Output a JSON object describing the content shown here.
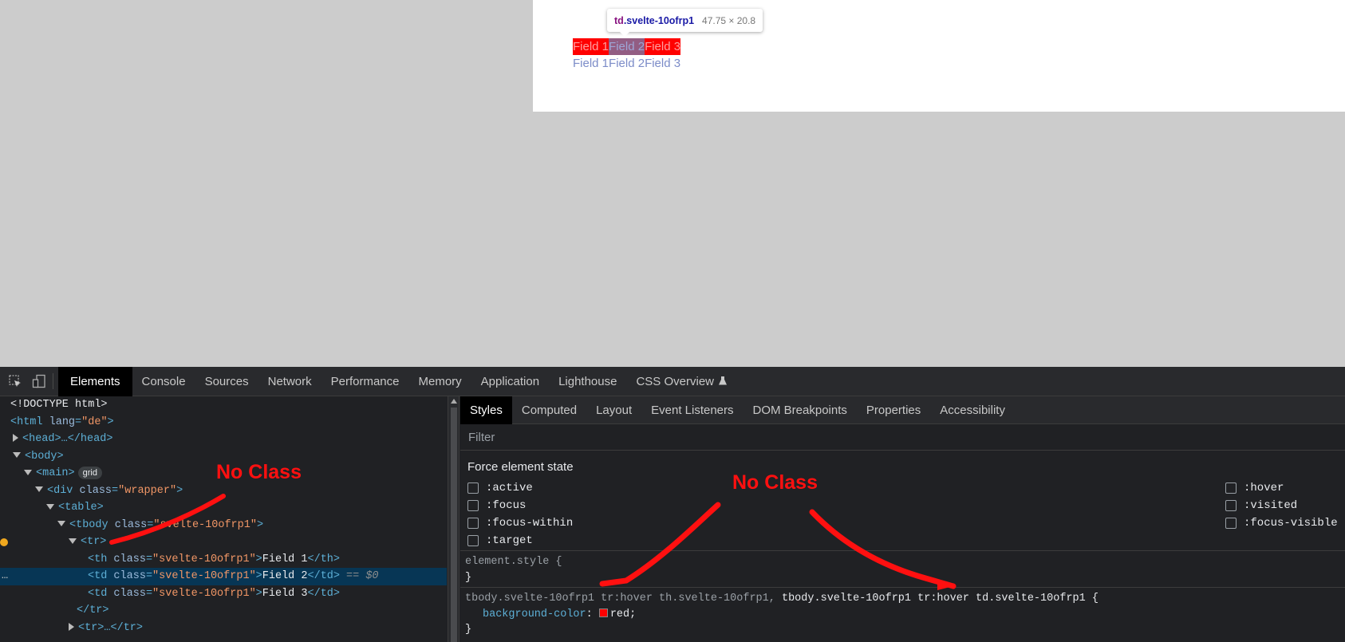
{
  "viewport": {
    "tooltip": {
      "tag": "td",
      "class": ".svelte-10ofrp1",
      "size": "47.75 × 20.8"
    },
    "rows": [
      [
        "Field 1",
        "Field 2",
        "Field 3"
      ],
      [
        "Field 1",
        "Field 2",
        "Field 3"
      ]
    ]
  },
  "devtools": {
    "tabs": [
      "Elements",
      "Console",
      "Sources",
      "Network",
      "Performance",
      "Memory",
      "Application",
      "Lighthouse",
      "CSS Overview"
    ],
    "icons": [
      "inspect-icon",
      "device-toggle-icon",
      "flask-icon"
    ],
    "dom": {
      "doctype": "<!DOCTYPE html>",
      "html_open": "<html",
      "html_attr": "lang",
      "html_val": "\"de\"",
      "head": "<head>…</head>",
      "body": "<body>",
      "main": "<main>",
      "main_badge": "grid",
      "div_tag": "<div",
      "div_attr": "class",
      "div_val": "\"wrapper\"",
      "table": "<table>",
      "tbody_tag": "<tbody",
      "tbody_attr": "class",
      "tbody_val": "\"svelte-10ofrp1\"",
      "tr": "<tr>",
      "th_tag": "<th",
      "cell_attr": "class",
      "cell_val": "\"svelte-10ofrp1\"",
      "th_text": "Field 1",
      "th_close": "</th>",
      "td_tag": "<td",
      "td2_text": "Field 2",
      "td3_text": "Field 3",
      "td_close": "</td>",
      "eq": "== $0",
      "tr_close": "</tr>",
      "tr_collapsed": "<tr>…</tr>"
    },
    "style_tabs": [
      "Styles",
      "Computed",
      "Layout",
      "Event Listeners",
      "DOM Breakpoints",
      "Properties",
      "Accessibility"
    ],
    "filter_placeholder": "Filter",
    "force_state_title": "Force element state",
    "states_left": [
      ":active",
      ":focus",
      ":focus-within",
      ":target"
    ],
    "states_right": [
      ":hover",
      ":visited",
      ":focus-visible"
    ],
    "element_style": "element.style {",
    "close_brace": "}",
    "rule_selector_dim": "tbody.svelte-10ofrp1 tr:hover th.svelte-10ofrp1,",
    "rule_selector_active": "tbody.svelte-10ofrp1 tr:hover td.svelte-10ofrp1 {",
    "rule_prop": "background-color",
    "rule_value": "red",
    "swatch_color": "#ff0000"
  },
  "annotations": {
    "left": "No Class",
    "right": "No Class"
  }
}
